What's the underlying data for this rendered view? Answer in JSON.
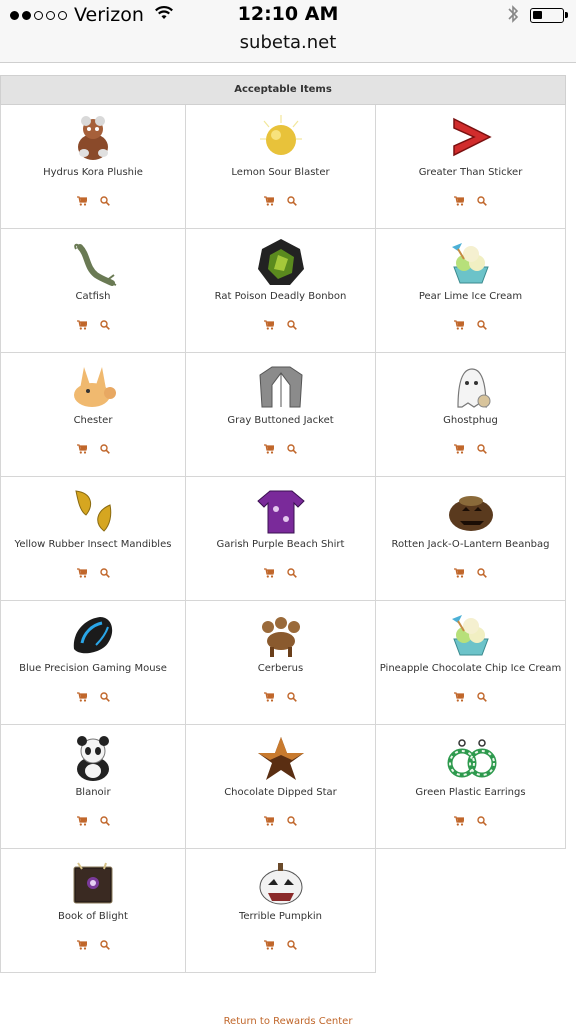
{
  "status_bar": {
    "carrier": "Verizon",
    "time": "12:10 AM",
    "signal_bars": 2,
    "battery_level": 0.35
  },
  "browser": {
    "url": "subeta.net"
  },
  "section": {
    "title": "Acceptable Items"
  },
  "items": [
    {
      "name": "Hydrus Kora Plushie",
      "icon": "plushie-icon"
    },
    {
      "name": "Lemon Sour Blaster",
      "icon": "lemon-candy-icon"
    },
    {
      "name": "Greater Than Sticker",
      "icon": "greater-than-sticker-icon"
    },
    {
      "name": "Catfish",
      "icon": "catfish-icon"
    },
    {
      "name": "Rat Poison Deadly Bonbon",
      "icon": "bonbon-icon"
    },
    {
      "name": "Pear Lime Ice Cream",
      "icon": "ice-cream-icon"
    },
    {
      "name": "Chester",
      "icon": "chester-pet-icon"
    },
    {
      "name": "Gray Buttoned Jacket",
      "icon": "jacket-icon"
    },
    {
      "name": "Ghostphug",
      "icon": "ghost-icon"
    },
    {
      "name": "Yellow Rubber Insect Mandibles",
      "icon": "mandibles-icon"
    },
    {
      "name": "Garish Purple Beach Shirt",
      "icon": "shirt-icon"
    },
    {
      "name": "Rotten Jack-O-Lantern Beanbag",
      "icon": "beanbag-icon"
    },
    {
      "name": "Blue Precision Gaming Mouse",
      "icon": "gaming-mouse-icon"
    },
    {
      "name": "Cerberus",
      "icon": "cerberus-icon"
    },
    {
      "name": "Pineapple Chocolate Chip Ice Cream",
      "icon": "ice-cream-icon"
    },
    {
      "name": "Blanoir",
      "icon": "panda-icon"
    },
    {
      "name": "Chocolate Dipped Star",
      "icon": "chocolate-star-icon"
    },
    {
      "name": "Green Plastic Earrings",
      "icon": "earrings-icon"
    },
    {
      "name": "Book of Blight",
      "icon": "book-icon"
    },
    {
      "name": "Terrible Pumpkin",
      "icon": "pumpkin-icon"
    }
  ],
  "item_actions": [
    {
      "icon": "cart-icon",
      "label": "shop"
    },
    {
      "icon": "search-icon",
      "label": "search"
    }
  ],
  "footer": {
    "link_text": "Return to Rewards Center"
  },
  "colors": {
    "accent": "#c0662a",
    "header_bg": "#e3e3e3",
    "grid_border": "#d6d6d6"
  }
}
